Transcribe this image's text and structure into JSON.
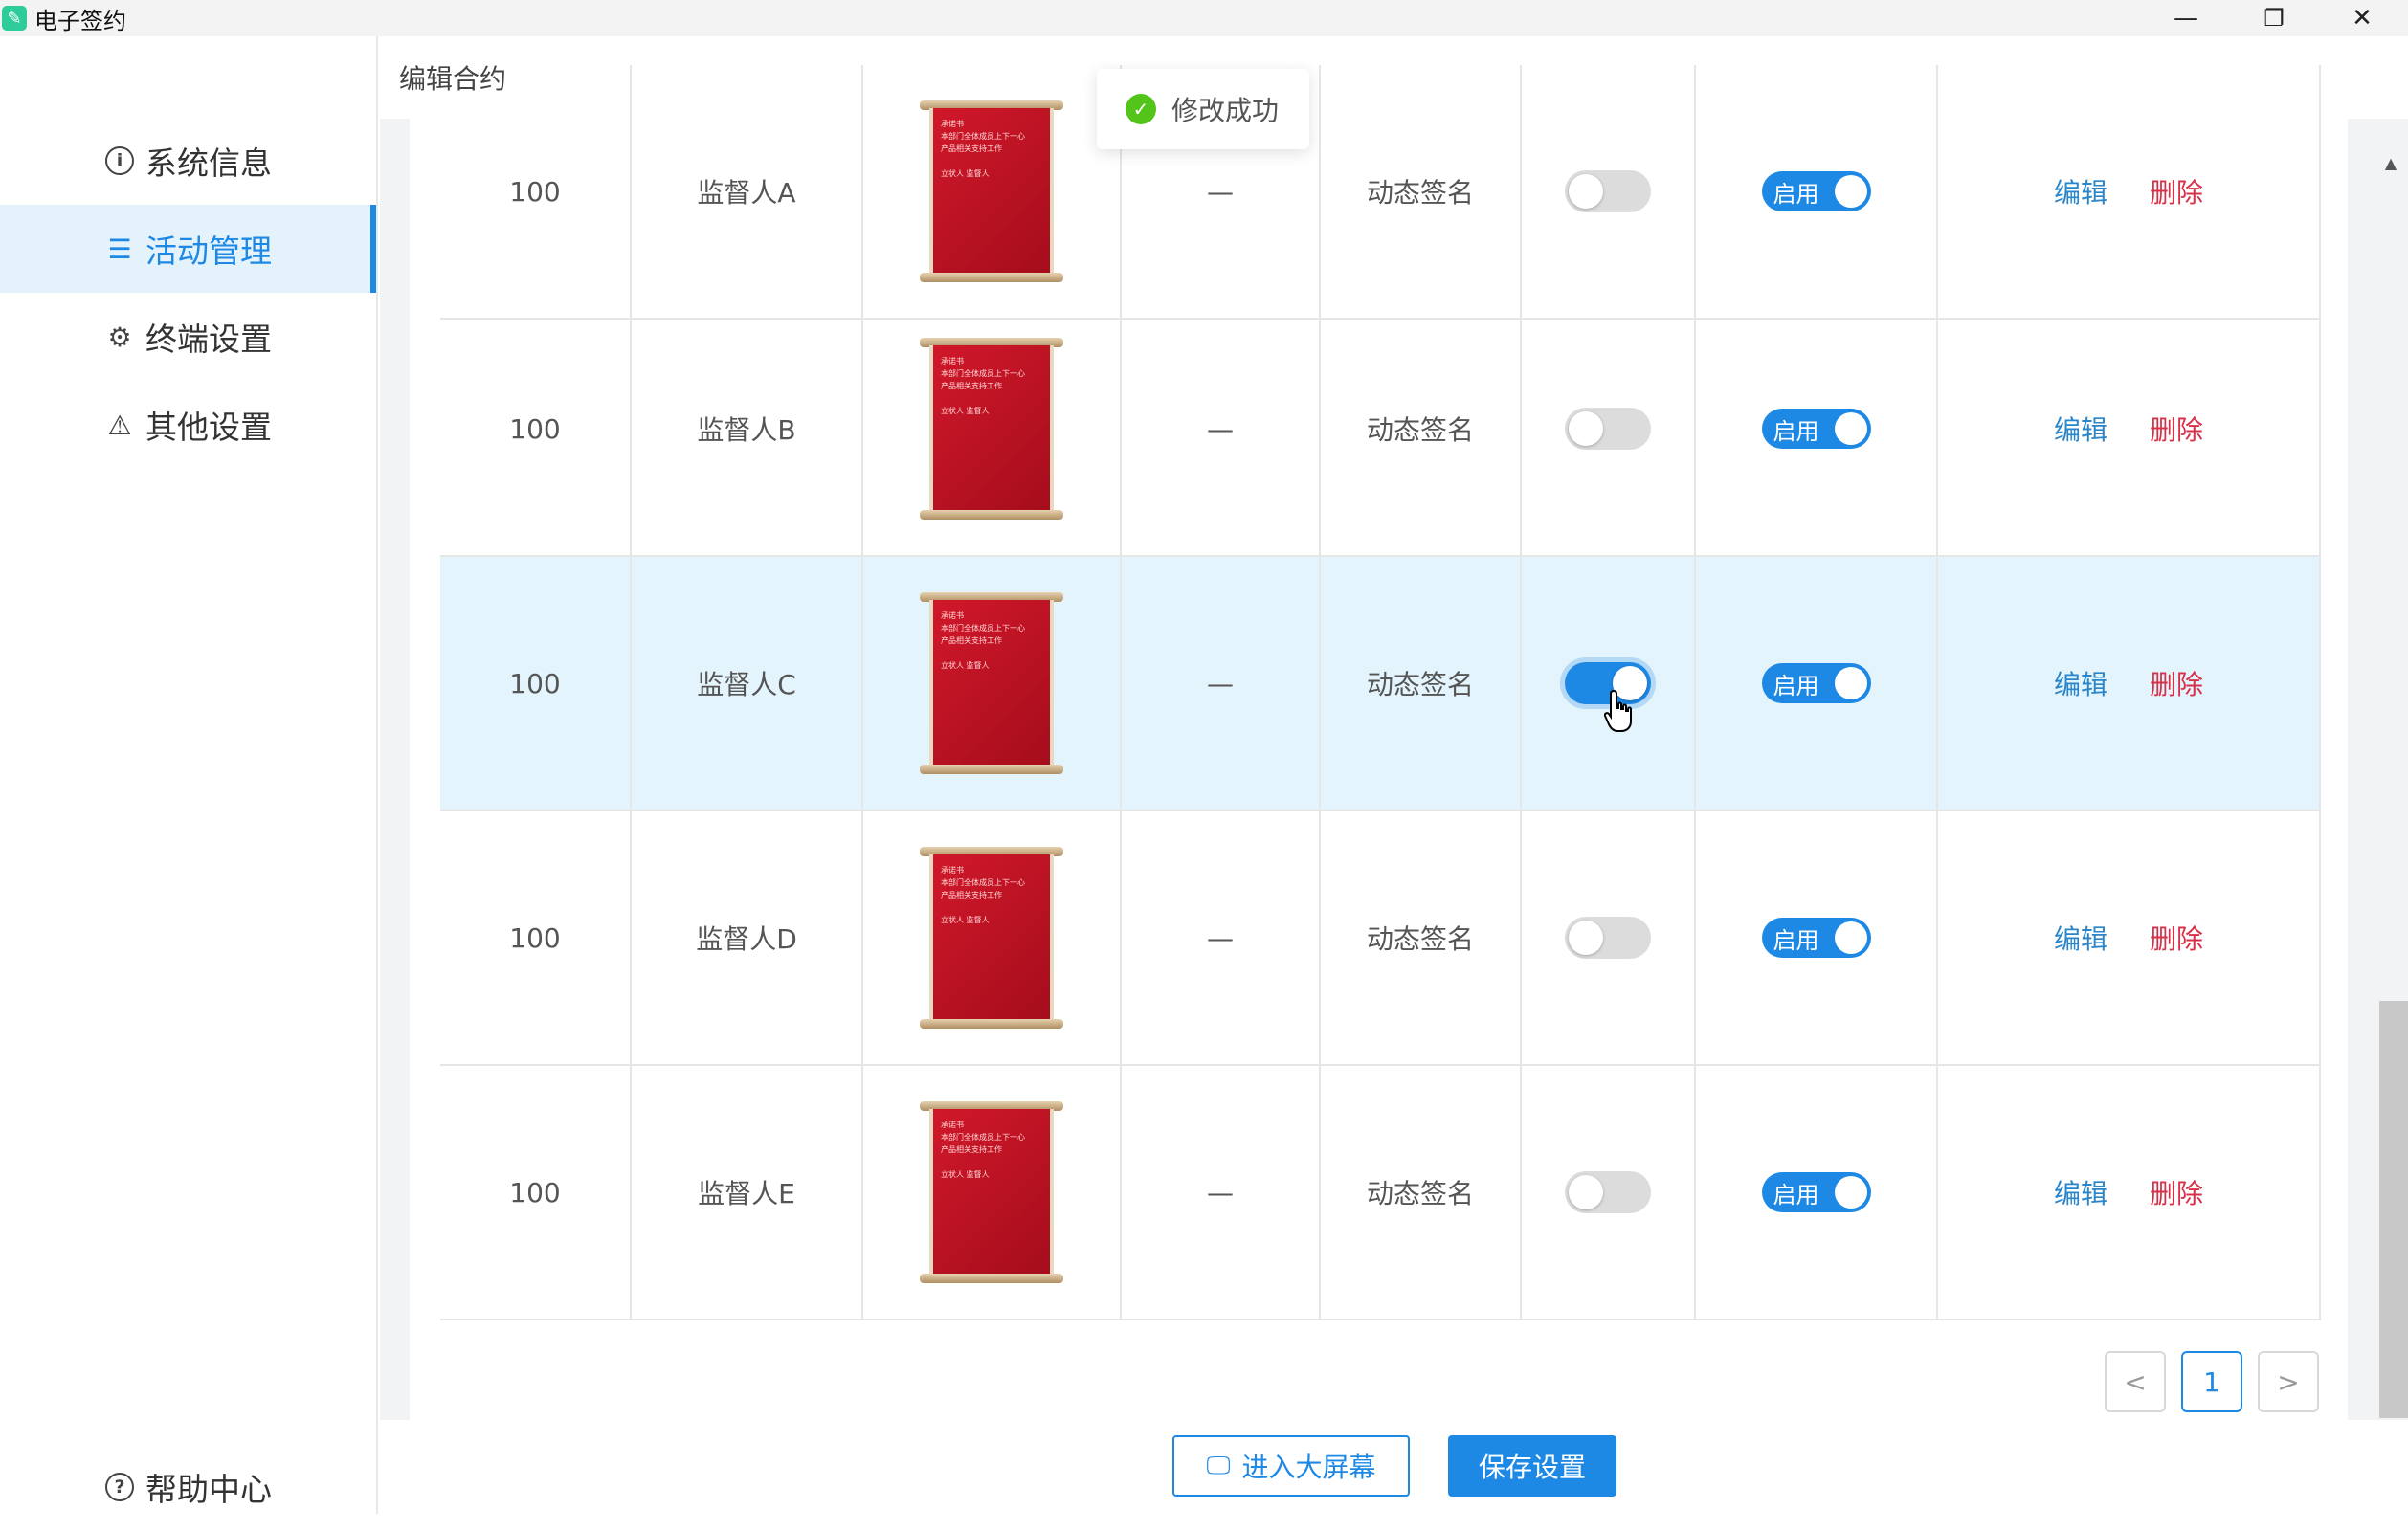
{
  "window": {
    "title": "电子签约",
    "controls": [
      "minimize-icon",
      "restore-icon",
      "close-icon"
    ]
  },
  "sidebar": {
    "items": [
      {
        "label": "系统信息",
        "icon": "info-icon"
      },
      {
        "label": "活动管理",
        "icon": "list-icon",
        "active": true
      },
      {
        "label": "终端设置",
        "icon": "gear-icon"
      },
      {
        "label": "其他设置",
        "icon": "warning-triangle-icon"
      }
    ],
    "help": {
      "label": "帮助中心",
      "icon": "help-circle-icon"
    }
  },
  "header": {
    "title": "编辑合约"
  },
  "toast": {
    "text": "修改成功",
    "icon": "check-circle-icon"
  },
  "table": {
    "rows": [
      {
        "count": "100",
        "supervisor": "监督人A",
        "dash": "—",
        "type": "动态签名",
        "toggle_on": false,
        "status_label": "启用",
        "edit": "编辑",
        "delete": "删除"
      },
      {
        "count": "100",
        "supervisor": "监督人B",
        "dash": "—",
        "type": "动态签名",
        "toggle_on": false,
        "status_label": "启用",
        "edit": "编辑",
        "delete": "删除"
      },
      {
        "count": "100",
        "supervisor": "监督人C",
        "dash": "—",
        "type": "动态签名",
        "toggle_on": true,
        "status_label": "启用",
        "edit": "编辑",
        "delete": "删除"
      },
      {
        "count": "100",
        "supervisor": "监督人D",
        "dash": "—",
        "type": "动态签名",
        "toggle_on": false,
        "status_label": "启用",
        "edit": "编辑",
        "delete": "删除"
      },
      {
        "count": "100",
        "supervisor": "监督人E",
        "dash": "—",
        "type": "动态签名",
        "toggle_on": false,
        "status_label": "启用",
        "edit": "编辑",
        "delete": "删除"
      }
    ]
  },
  "pagination": {
    "prev": "<",
    "current": "1",
    "next": ">"
  },
  "footer": {
    "big_screen": "进入大屏幕",
    "save": "保存设置"
  },
  "colors": {
    "accent": "#1e88e5",
    "danger": "#d9304a",
    "success": "#52c41a",
    "highlight_row": "#e4f4fc"
  }
}
